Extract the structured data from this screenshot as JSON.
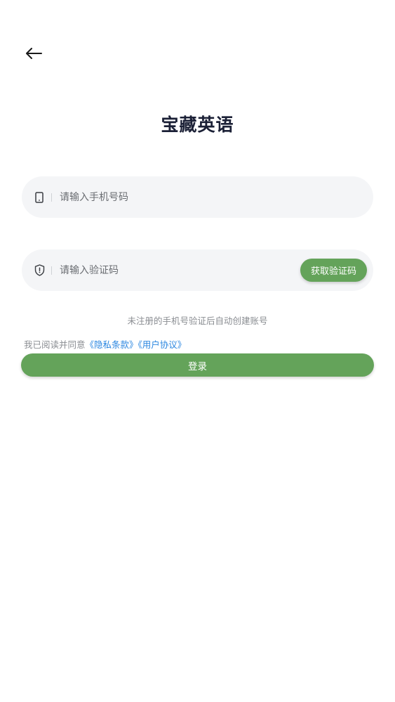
{
  "header": {
    "back_icon": "arrow-left-icon"
  },
  "app": {
    "title": "宝藏英语"
  },
  "phone_field": {
    "icon": "phone-icon",
    "value": "",
    "placeholder": "请输入手机号码"
  },
  "code_field": {
    "icon": "shield-icon",
    "value": "",
    "placeholder": "请输入验证码",
    "get_code_label": "获取验证码"
  },
  "hint": "未注册的手机号验证后自动创建账号",
  "agreement": {
    "prefix": "我已阅读并同意",
    "privacy_link": "《隐私条款》",
    "user_link": "《用户协议》"
  },
  "login": {
    "label": "登录"
  },
  "colors": {
    "accent": "#64a35a",
    "link": "#2a86e0",
    "title": "#1b2036",
    "field_bg": "#f4f5f7"
  }
}
